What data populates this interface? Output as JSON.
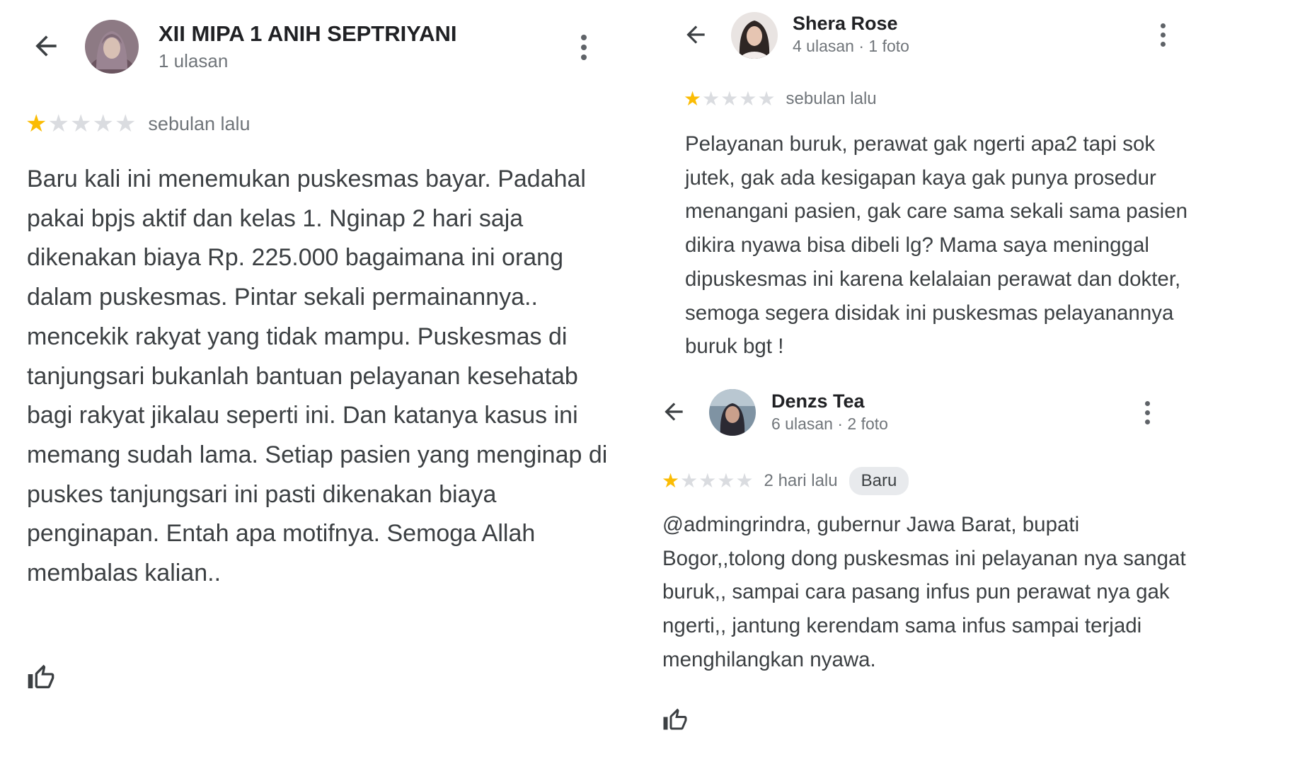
{
  "colors": {
    "star_filled": "#fbbc04",
    "star_empty": "#dadce0",
    "text": "#3c4043",
    "secondary_text": "#70757a",
    "badge_bg": "#e8eaed"
  },
  "icons": {
    "back": "arrow-back-icon",
    "menu": "more-vert-icon",
    "star": "star-icon",
    "like": "thumb-up-icon"
  },
  "reviews": [
    {
      "reviewer_name": "XII MIPA 1 ANIH SEPTRIYANI",
      "reviewer_meta": "1 ulasan",
      "rating": 1,
      "rating_max": 5,
      "time": "sebulan lalu",
      "text": "Baru kali ini menemukan puskesmas bayar. Padahal pakai bpjs aktif dan kelas 1. Nginap 2 hari saja dikenakan biaya Rp. 225.000 bagaimana ini orang dalam puskesmas. Pintar sekali permainannya.. mencekik rakyat yang tidak mampu. Puskesmas di tanjungsari bukanlah bantuan pelayanan kesehatab bagi rakyat jikalau seperti ini. Dan katanya kasus ini memang sudah lama. Setiap pasien yang menginap di puskes tanjungsari ini pasti dikenakan biaya penginapan. Entah apa motifnya. Semoga Allah membalas kalian.."
    },
    {
      "reviewer_name": "Shera Rose",
      "reviewer_meta": "4 ulasan · 1 foto",
      "rating": 1,
      "rating_max": 5,
      "time": "sebulan lalu",
      "text": "Pelayanan buruk, perawat gak ngerti apa2 tapi sok jutek, gak ada kesigapan kaya gak punya prosedur menangani pasien, gak care sama sekali sama pasien dikira nyawa bisa dibeli lg? Mama saya meninggal dipuskesmas ini karena kelalaian perawat dan dokter, semoga segera disidak ini puskesmas pelayanannya buruk bgt !"
    },
    {
      "reviewer_name": "Denzs Tea",
      "reviewer_meta": "6 ulasan · 2 foto",
      "rating": 1,
      "rating_max": 5,
      "time": "2 hari lalu",
      "badge": "Baru",
      "text": "@admingrindra, gubernur Jawa Barat, bupati Bogor,,tolong dong puskesmas ini pelayanan nya sangat buruk,, sampai cara pasang infus pun perawat nya gak ngerti,, jantung kerendam sama infus sampai terjadi menghilangkan nyawa."
    }
  ]
}
